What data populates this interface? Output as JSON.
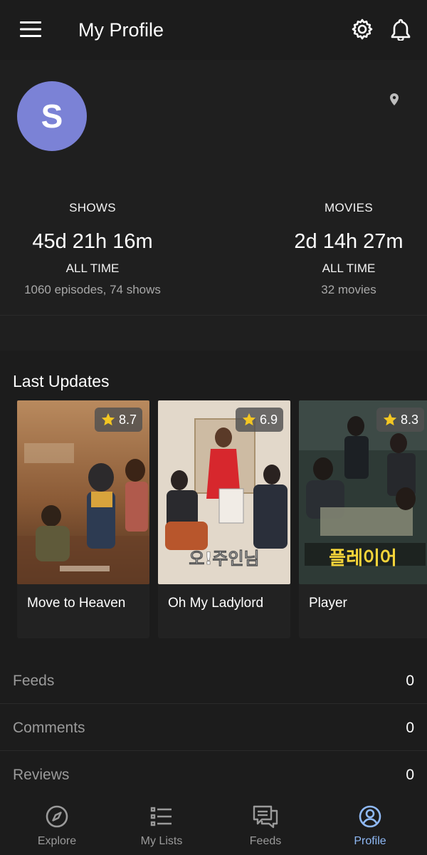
{
  "header": {
    "title": "My Profile",
    "menu_icon": "menu-icon",
    "settings_icon": "gear-icon",
    "notifications_icon": "bell-icon"
  },
  "profile": {
    "avatar_initial": "S",
    "avatar_color": "#7b82d6",
    "location_icon": "location-pin-icon"
  },
  "stats": {
    "shows": {
      "heading": "SHOWS",
      "time": "45d 21h 16m",
      "period": "ALL TIME",
      "detail": "1060 episodes, 74 shows"
    },
    "movies": {
      "heading": "MOVIES",
      "time": "2d 14h 27m",
      "period": "ALL TIME",
      "detail": "32 movies"
    }
  },
  "last_updates": {
    "title": "Last Updates",
    "items": [
      {
        "title": "Move to Heaven",
        "rating": "8.7"
      },
      {
        "title": "Oh My Ladylord",
        "rating": "6.9"
      },
      {
        "title": "Player",
        "rating": "8.3"
      }
    ]
  },
  "activity": [
    {
      "label": "Feeds",
      "count": "0"
    },
    {
      "label": "Comments",
      "count": "0"
    },
    {
      "label": "Reviews",
      "count": "0"
    }
  ],
  "bottom_nav": {
    "active_color": "#8fb9f5",
    "items": [
      {
        "label": "Explore",
        "icon": "compass-icon"
      },
      {
        "label": "My Lists",
        "icon": "list-icon"
      },
      {
        "label": "Feeds",
        "icon": "chat-feed-icon"
      },
      {
        "label": "Profile",
        "icon": "profile-icon"
      }
    ]
  }
}
